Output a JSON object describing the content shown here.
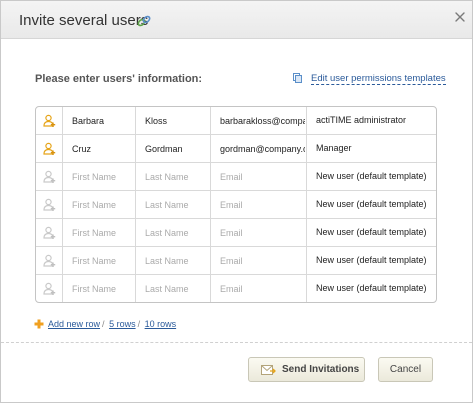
{
  "dialog": {
    "title": "Invite several users",
    "section_label": "Please enter users' information:",
    "permissions_link": "Edit user permissions templates"
  },
  "placeholders": {
    "first": "First Name",
    "last": "Last Name",
    "email": "Email"
  },
  "rows": [
    {
      "first": "Barbara",
      "last": "Kloss",
      "email": "barbarakloss@company.com",
      "role": "actiTIME administrator",
      "filled": true
    },
    {
      "first": "Cruz",
      "last": "Gordman",
      "email": "gordman@company.com",
      "role": "Manager",
      "filled": true
    },
    {
      "first": "",
      "last": "",
      "email": "",
      "role": "New user (default template)",
      "filled": false
    },
    {
      "first": "",
      "last": "",
      "email": "",
      "role": "New user (default template)",
      "filled": false
    },
    {
      "first": "",
      "last": "",
      "email": "",
      "role": "New user (default template)",
      "filled": false
    },
    {
      "first": "",
      "last": "",
      "email": "",
      "role": "New user (default template)",
      "filled": false
    },
    {
      "first": "",
      "last": "",
      "email": "",
      "role": "New user (default template)",
      "filled": false
    }
  ],
  "footer": {
    "add_row": "Add new row",
    "five_rows": "5 rows",
    "ten_rows": "10 rows",
    "separator": "/"
  },
  "buttons": {
    "send": "Send Invitations",
    "cancel": "Cancel"
  },
  "colors": {
    "link": "#2a5a9a",
    "user_icon_active": "#e6a419",
    "user_icon_inactive": "#c9c9c9",
    "add_icon": "#f0a020"
  }
}
